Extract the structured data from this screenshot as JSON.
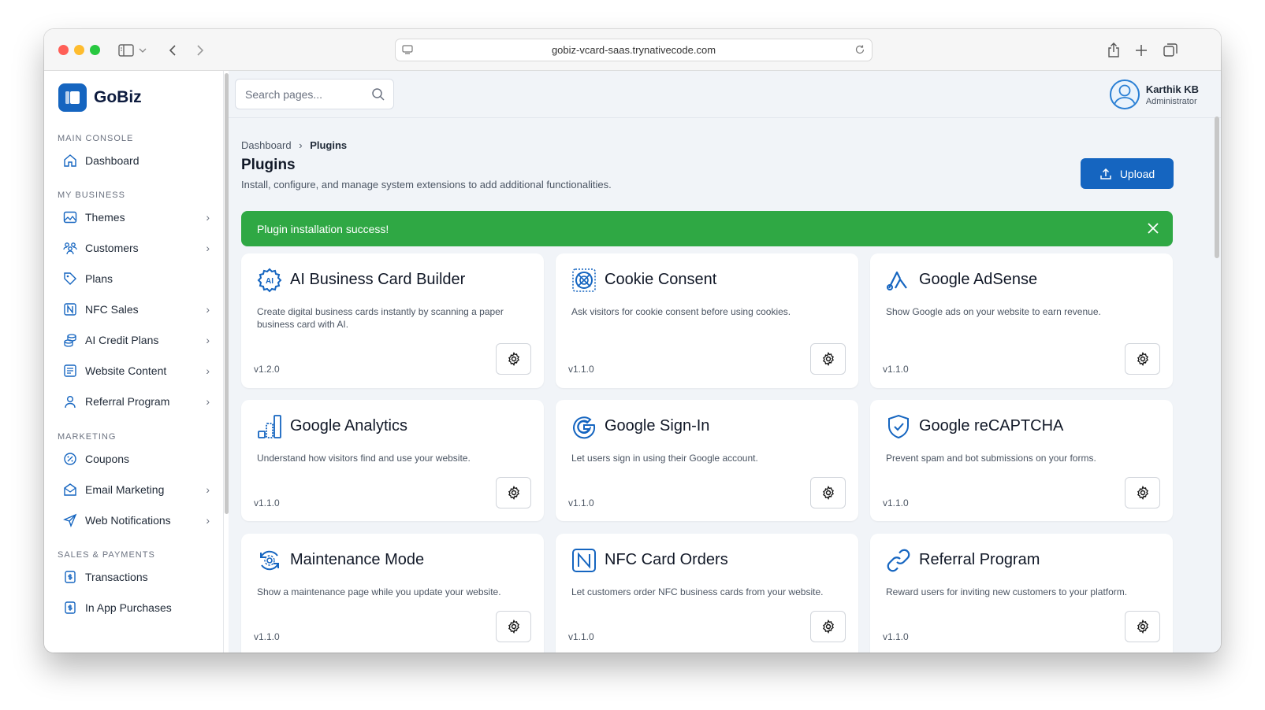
{
  "browser": {
    "url": "gobiz-vcard-saas.trynativecode.com"
  },
  "brand": {
    "name": "GoBiz",
    "color": "#1565c0"
  },
  "sidebar": {
    "sections": [
      {
        "title": "MAIN CONSOLE"
      },
      {
        "title": "MY BUSINESS"
      },
      {
        "title": "MARKETING"
      },
      {
        "title": "SALES & PAYMENTS"
      }
    ],
    "items": [
      {
        "label": "Dashboard",
        "icon": "home-icon",
        "chevron": false
      },
      {
        "label": "Themes",
        "icon": "image-icon",
        "chevron": true
      },
      {
        "label": "Customers",
        "icon": "users-icon",
        "chevron": true
      },
      {
        "label": "Plans",
        "icon": "tag-icon",
        "chevron": false
      },
      {
        "label": "NFC Sales",
        "icon": "nfc-icon",
        "chevron": true
      },
      {
        "label": "AI Credit Plans",
        "icon": "coins-icon",
        "chevron": true
      },
      {
        "label": "Website Content",
        "icon": "content-icon",
        "chevron": true
      },
      {
        "label": "Referral Program",
        "icon": "user-icon",
        "chevron": true
      },
      {
        "label": "Coupons",
        "icon": "percent-icon",
        "chevron": false
      },
      {
        "label": "Email Marketing",
        "icon": "mail-icon",
        "chevron": true
      },
      {
        "label": "Web Notifications",
        "icon": "send-icon",
        "chevron": true
      },
      {
        "label": "Transactions",
        "icon": "receipt-icon",
        "chevron": false
      },
      {
        "label": "In App Purchases",
        "icon": "receipt-icon",
        "chevron": false
      }
    ]
  },
  "topbar": {
    "search_placeholder": "Search pages...",
    "user_name": "Karthik KB",
    "user_role": "Administrator"
  },
  "page": {
    "breadcrumb_root": "Dashboard",
    "breadcrumb_sep": "›",
    "breadcrumb_current": "Plugins",
    "title": "Plugins",
    "subtitle": "Install, configure, and manage system extensions to add additional functionalities.",
    "upload_label": "Upload"
  },
  "alert": {
    "message": "Plugin installation success!",
    "color": "#2fa844"
  },
  "plugins": [
    {
      "title": "AI Business Card Builder",
      "desc": "Create digital business cards instantly by scanning a paper business card with AI.",
      "version": "v1.2.0",
      "icon": "ai-gear-icon"
    },
    {
      "title": "Cookie Consent",
      "desc": "Ask visitors for cookie consent before using cookies.",
      "version": "v1.1.0",
      "icon": "cookie-icon"
    },
    {
      "title": "Google AdSense",
      "desc": "Show Google ads on your website to earn revenue.",
      "version": "v1.1.0",
      "icon": "adsense-icon"
    },
    {
      "title": "Google Analytics",
      "desc": "Understand how visitors find and use your website.",
      "version": "v1.1.0",
      "icon": "analytics-icon"
    },
    {
      "title": "Google Sign-In",
      "desc": "Let users sign in using their Google account.",
      "version": "v1.1.0",
      "icon": "google-icon"
    },
    {
      "title": "Google reCAPTCHA",
      "desc": "Prevent spam and bot submissions on your forms.",
      "version": "v1.1.0",
      "icon": "shield-check-icon"
    },
    {
      "title": "Maintenance Mode",
      "desc": "Show a maintenance page while you update your website.",
      "version": "v1.1.0",
      "icon": "maintenance-icon"
    },
    {
      "title": "NFC Card Orders",
      "desc": "Let customers order NFC business cards from your website.",
      "version": "v1.1.0",
      "icon": "nfc-icon"
    },
    {
      "title": "Referral Program",
      "desc": "Reward users for inviting new customers to your platform.",
      "version": "v1.1.0",
      "icon": "link-icon"
    }
  ]
}
